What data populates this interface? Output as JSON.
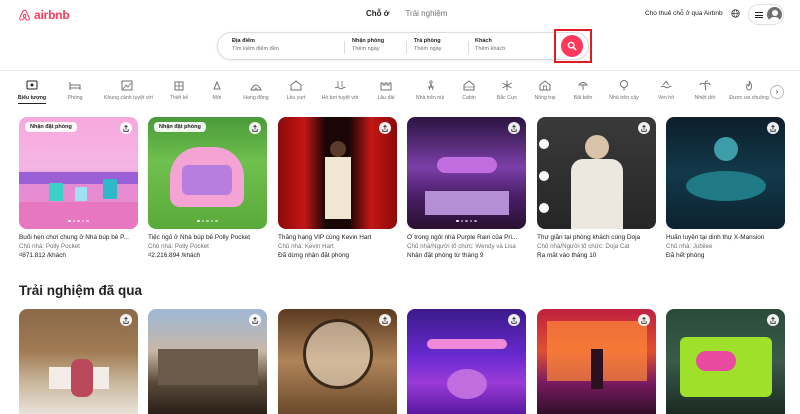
{
  "brand": {
    "name": "airbnb",
    "color": "#ff385c"
  },
  "header": {
    "tabs": [
      {
        "label": "Chỗ ở",
        "active": true
      },
      {
        "label": "Trải nghiệm",
        "active": false
      }
    ],
    "host_link": "Cho thuê chỗ ở qua Airbnb",
    "globe_icon": "globe-icon",
    "menu_icon": "hamburger-icon",
    "avatar_icon": "user-avatar-icon"
  },
  "search": {
    "where": {
      "label": "Địa điểm",
      "placeholder": "Tìm kiếm điểm đến"
    },
    "checkin": {
      "label": "Nhận phòng",
      "placeholder": "Thêm ngày"
    },
    "checkout": {
      "label": "Trả phòng",
      "placeholder": "Thêm ngày"
    },
    "guests": {
      "label": "Khách",
      "placeholder": "Thêm khách"
    },
    "button_icon": "search-icon",
    "highlight_color": "#e01b24"
  },
  "categories": [
    {
      "label": "Biểu tượng",
      "icon": "icons-category-icon",
      "active": true
    },
    {
      "label": "Phòng",
      "icon": "bed-icon"
    },
    {
      "label": "Khung cảnh tuyệt vời",
      "icon": "view-icon"
    },
    {
      "label": "Thiết kế",
      "icon": "design-icon"
    },
    {
      "label": "Mới",
      "icon": "new-icon"
    },
    {
      "label": "Hang động",
      "icon": "cave-icon"
    },
    {
      "label": "Lều yurt",
      "icon": "yurt-icon"
    },
    {
      "label": "Hồ bơi tuyệt vời",
      "icon": "pool-icon"
    },
    {
      "label": "Lâu đài",
      "icon": "castle-icon"
    },
    {
      "label": "Nhà trên núi",
      "icon": "mountain-icon"
    },
    {
      "label": "Cabin",
      "icon": "cabin-icon"
    },
    {
      "label": "Bắc Cực",
      "icon": "snowflake-icon"
    },
    {
      "label": "Nông trại",
      "icon": "farm-icon"
    },
    {
      "label": "Bãi biển",
      "icon": "beach-icon"
    },
    {
      "label": "Nhà trên cây",
      "icon": "treehouse-icon"
    },
    {
      "label": "Ven hồ",
      "icon": "lake-icon"
    },
    {
      "label": "Nhiệt đới",
      "icon": "tropical-icon"
    },
    {
      "label": "Được ưa chuộng",
      "icon": "trending-icon"
    }
  ],
  "listings": [
    {
      "badge": "Nhận đặt phòng",
      "title": "Buổi hẹn chơi chung ở Nhà búp bê P...",
      "host": "Chủ nhà: Polly Pocket",
      "sub": "₫871.812 /khách"
    },
    {
      "badge": "Nhận đặt phòng",
      "title": "Tiệc ngủ ở Nhà búp bê Polly Pocket",
      "host": "Chủ nhà: Polly Pocket",
      "sub": "₫2.216.894 /khách"
    },
    {
      "badge": "",
      "title": "Thăng hạng VIP cùng Kevin Hart",
      "host": "Chủ nhà: Kevin Hart",
      "sub": "Đã dừng nhận đặt phòng"
    },
    {
      "badge": "",
      "title": "Ở trong ngôi nhà Purple Rain của Pri...",
      "host": "Chủ nhà/Người tổ chức: Wendy và Lisa",
      "sub": "Nhận đặt phòng từ tháng 9"
    },
    {
      "badge": "",
      "title": "Thư giãn tại phòng khách cùng Doja",
      "host": "Chủ nhà/Người tổ chức: Doja Cat",
      "sub": "Ra mắt vào tháng 10"
    },
    {
      "badge": "",
      "title": "Huấn luyện tại dinh thự X-Mansion",
      "host": "Chủ nhà: Jubilee",
      "sub": "Đã hết phòng"
    }
  ],
  "past_section": {
    "title": "Trải nghiệm đã qua"
  },
  "icons": {
    "share": "share-icon",
    "next": "chevron-right-icon"
  }
}
